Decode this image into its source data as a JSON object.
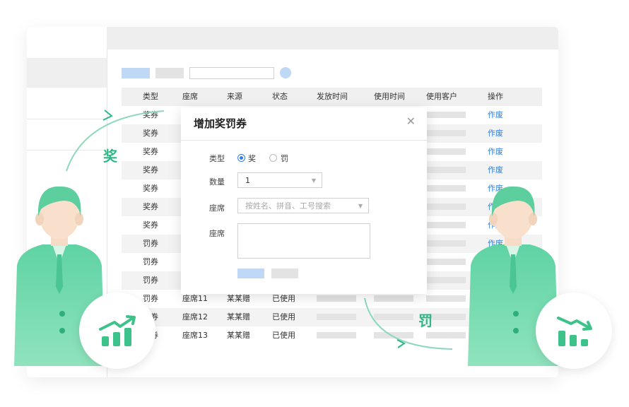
{
  "table": {
    "headers": [
      "类型",
      "座席",
      "来源",
      "状态",
      "发放时间",
      "使用时间",
      "使用客户",
      "操作"
    ],
    "rows": [
      {
        "type": "奖券",
        "seat": "",
        "source": "",
        "status": "",
        "action": "作废"
      },
      {
        "type": "奖券",
        "seat": "",
        "source": "",
        "status": "",
        "action": "作废"
      },
      {
        "type": "奖券",
        "seat": "",
        "source": "",
        "status": "",
        "action": "作废"
      },
      {
        "type": "奖券",
        "seat": "",
        "source": "",
        "status": "",
        "action": "作废"
      },
      {
        "type": "奖券",
        "seat": "",
        "source": "",
        "status": "",
        "action": "作废"
      },
      {
        "type": "奖券",
        "seat": "",
        "source": "",
        "status": "",
        "action": "作废"
      },
      {
        "type": "奖券",
        "seat": "",
        "source": "",
        "status": "",
        "action": "作废"
      },
      {
        "type": "罚券",
        "seat": "",
        "source": "",
        "status": "",
        "action": "作废"
      },
      {
        "type": "罚券",
        "seat": "",
        "source": "",
        "status": "",
        "action": ""
      },
      {
        "type": "罚券",
        "seat": "",
        "source": "",
        "status": "",
        "action": ""
      },
      {
        "type": "罚券",
        "seat": "座席11",
        "source": "某某赠",
        "status": "已使用",
        "action": ""
      },
      {
        "type": "罚券",
        "seat": "座席12",
        "source": "某某赠",
        "status": "已使用",
        "action": ""
      },
      {
        "type": "罚券",
        "seat": "座席13",
        "source": "某某赠",
        "status": "已使用",
        "action": ""
      }
    ]
  },
  "dialog": {
    "title": "增加奖罚券",
    "type_label": "类型",
    "option_reward": "奖",
    "option_penalty": "罚",
    "quantity_label": "数量",
    "quantity_value": "1",
    "seat_label": "座席",
    "seat_placeholder": "按姓名、拼音、工号搜索",
    "seat_label_2": "座席"
  },
  "decor": {
    "reward_word": "奖",
    "penalty_word": "罚",
    "accent_green": "#2eb888",
    "accent_blue": "#2f7fe0"
  }
}
